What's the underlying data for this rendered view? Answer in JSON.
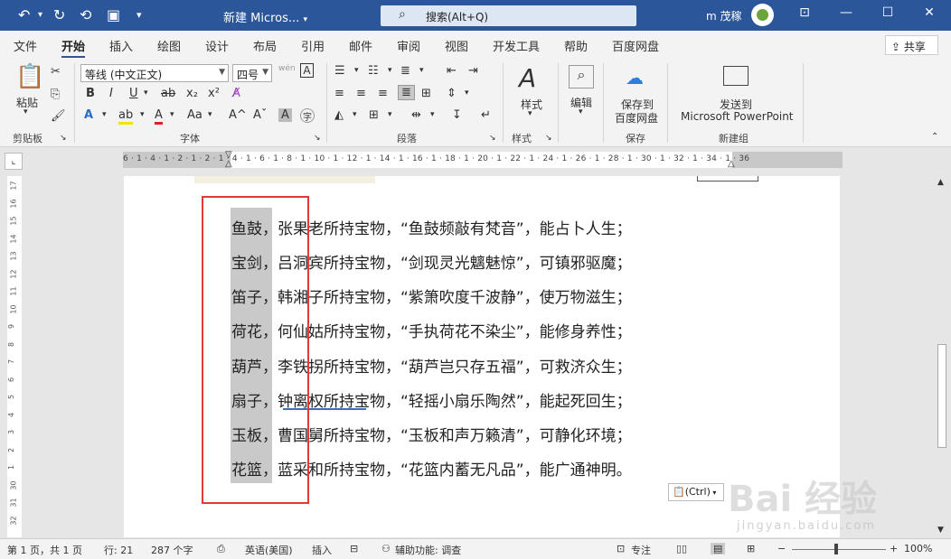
{
  "titlebar": {
    "doc_title": "新建 Micros...",
    "title_caret": "▾",
    "search_placeholder": "搜索(Alt+Q)",
    "user_name": "m 茂稼"
  },
  "tabs": [
    "文件",
    "开始",
    "插入",
    "绘图",
    "设计",
    "布局",
    "引用",
    "邮件",
    "审阅",
    "视图",
    "开发工具",
    "帮助",
    "百度网盘"
  ],
  "share_label": "共享",
  "ribbon": {
    "paste_label": "粘贴",
    "clipboard_group": "剪贴板",
    "font_name": "等线 (中文正文)",
    "font_size": "四号",
    "font_group": "字体",
    "paragraph_group": "段落",
    "styles_label": "样式",
    "styles_group": "样式",
    "edit_label": "编辑",
    "save_baidu_line1": "保存到",
    "save_baidu_line2": "百度网盘",
    "save_group": "保存",
    "send_line1": "发送到",
    "send_line2": "Microsoft PowerPoint",
    "new_group": "新建组"
  },
  "ruler_numbers": "6 · 1 · 4 · 1 · 2 · 1 · 2 · 1 · 4 · 1 · 6 · 1 · 8 · 1 · 10 · 1 · 12 · 1 · 14 · 1 · 16 · 1 · 18 · 1 · 20 · 1 · 22 · 1 · 24 · 1 · 26 · 1 · 28 · 1 · 30 · 1 · 32 · 1 · 34 · 1 · 36",
  "vruler_numbers": [
    "17",
    "16",
    "15",
    "14",
    "13",
    "12",
    "11",
    "10",
    "9",
    "8",
    "7",
    "6",
    "5",
    "4",
    "3",
    "2",
    "1",
    "30",
    "31",
    "32"
  ],
  "document": {
    "lines": [
      "鱼鼓，张果老所持宝物，“鱼鼓频敲有梵音”，能占卜人生；",
      "宝剑，吕洞宾所持宝物，“剑现灵光魑魅惊”，可镇邪驱魔；",
      "笛子，韩湘子所持宝物，“紫箫吹度千波静”，使万物滋生；",
      "荷花，何仙姑所持宝物，“手执荷花不染尘”，能修身养性；",
      "葫芦，李铁拐所持宝物，“葫芦岂只存五福”，可救济众生；",
      "扇子，钟离权所持宝物，“轻摇小扇乐陶然”，能起死回生；",
      "玉板，曹国舅所持宝物，“玉板和声万籁清”，可静化环境；",
      "花篮，蓝采和所持宝物，“花篮内蓄无凡品”，能广通神明。"
    ],
    "paste_options": "(Ctrl)"
  },
  "status": {
    "page": "第 1 页，共 1 页",
    "line": "行: 21",
    "words": "287 个字",
    "language": "英语(美国)",
    "insert": "插入",
    "accessibility": "辅助功能: 调查",
    "focus": "专注",
    "zoom": "100%"
  },
  "watermark": {
    "brand": "Bai 经验",
    "url": "jingyan.baidu.com"
  }
}
